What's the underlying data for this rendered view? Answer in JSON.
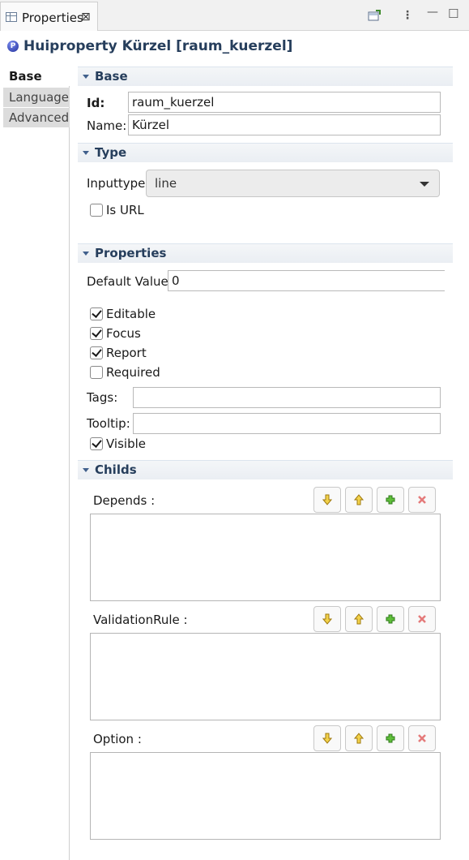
{
  "view": {
    "tab_label": "Properties",
    "close_glyph": "⊠",
    "toolbar": [
      {
        "name": "pin-to-selection-icon",
        "glyph": "⤒"
      },
      {
        "name": "view-menu-icon",
        "glyph": "⋮"
      },
      {
        "name": "minimize-icon",
        "glyph": "—"
      },
      {
        "name": "maximize-icon",
        "glyph": "☐"
      }
    ]
  },
  "title": {
    "icon_letter": "P",
    "text": "Huiproperty Kürzel [raum_kuerzel]"
  },
  "left_tabs": [
    {
      "label": "Base",
      "active": true
    },
    {
      "label": "Language",
      "active": false
    },
    {
      "label": "Advanced",
      "active": false
    }
  ],
  "sections": {
    "base": "Base",
    "type": "Type",
    "properties": "Properties",
    "childs": "Childs"
  },
  "base": {
    "id_label": "Id:",
    "id_value": "raum_kuerzel",
    "name_label": "Name:",
    "name_value": "Kürzel"
  },
  "type": {
    "inputtype_label": "Inputtype:",
    "inputtype_value": "line",
    "is_url_label": "Is URL",
    "is_url_checked": false
  },
  "properties": {
    "default_label": "Default Value:",
    "default_value": "0",
    "checkboxes": [
      {
        "label": "Editable",
        "checked": true
      },
      {
        "label": "Focus",
        "checked": true
      },
      {
        "label": "Report",
        "checked": true
      },
      {
        "label": "Required",
        "checked": false
      }
    ],
    "tags_label": "Tags:",
    "tags_value": "",
    "tooltip_label": "Tooltip:",
    "tooltip_value": "",
    "visible_label": "Visible",
    "visible_checked": true
  },
  "childs": [
    {
      "label": "Depends :",
      "items": []
    },
    {
      "label": "ValidationRule :",
      "items": []
    },
    {
      "label": "Option :",
      "items": []
    }
  ],
  "colors": {
    "accent": "#263e5c",
    "add": "#3c9a2a",
    "remove": "#e06060",
    "move": "#e0b020"
  }
}
